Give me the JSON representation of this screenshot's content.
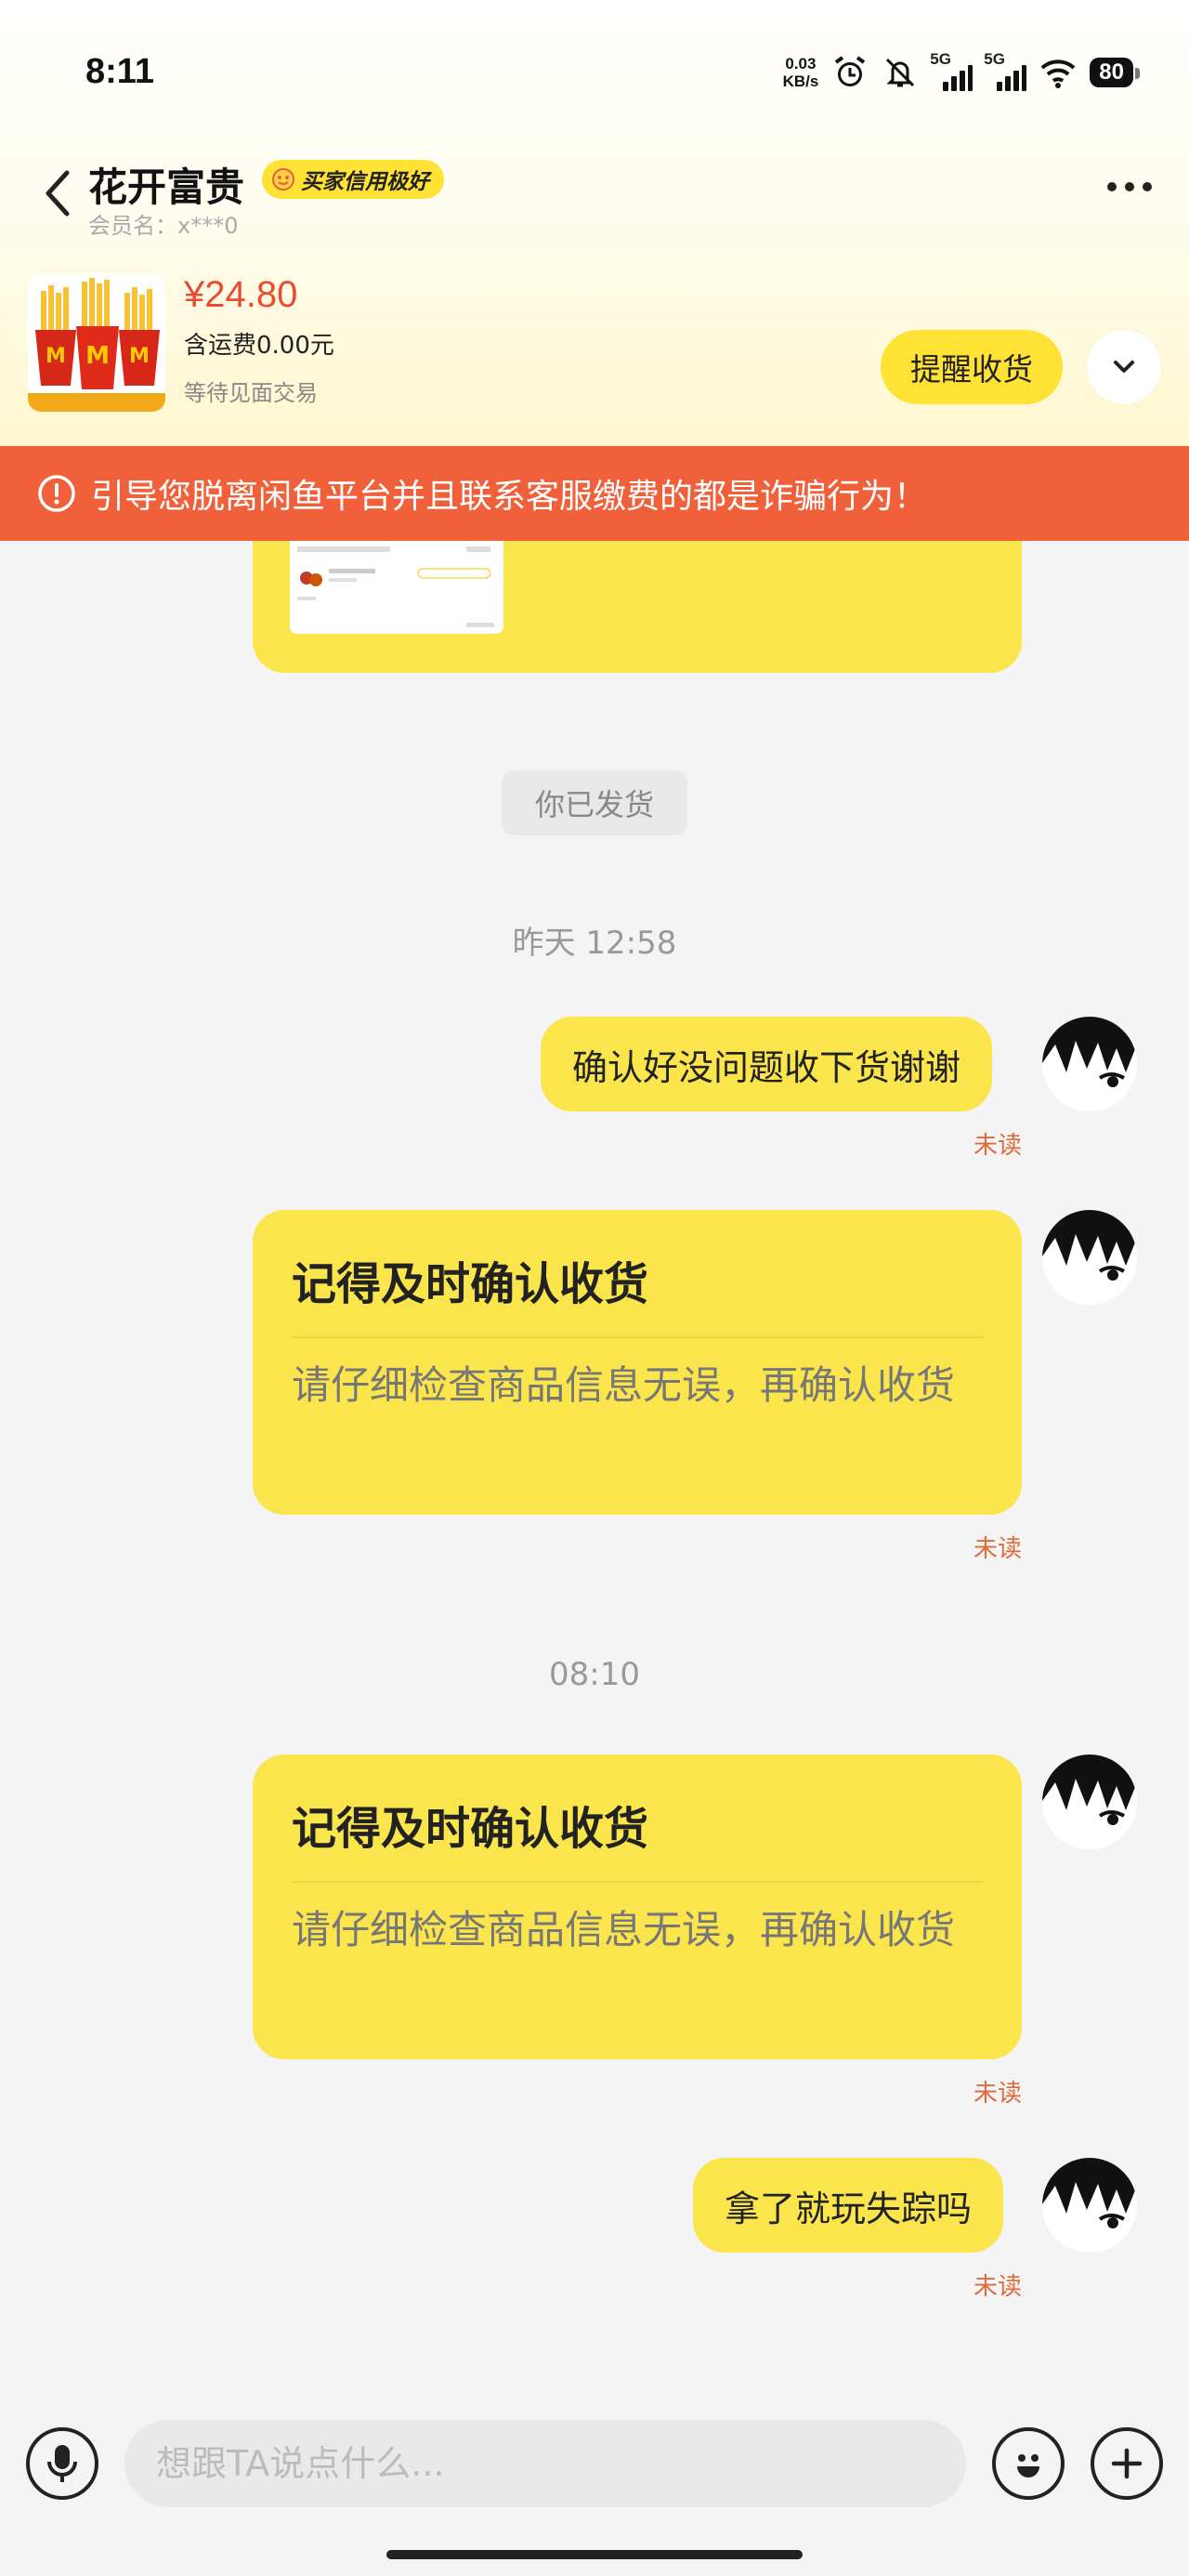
{
  "status_bar": {
    "time": "8:11",
    "net_speed_value": "0.03",
    "net_speed_unit": "KB/s",
    "sim1_label": "5G",
    "sim2_label": "5G",
    "battery": "80"
  },
  "header": {
    "seller_name": "花开富贵",
    "credit_badge": "买家信用极好",
    "member_label": "会员名：x***0"
  },
  "product": {
    "image": "fries-icon",
    "price": "¥24.80",
    "shipping": "含运费0.00元",
    "trade_status": "等待见面交易",
    "remind_button": "提醒收货"
  },
  "warning": {
    "text": "引导您脱离闲鱼平台并且联系客服缴费的都是诈骗行为！"
  },
  "chat": {
    "system_notice": "你已发货",
    "timestamp_1": "昨天 12:58",
    "msg_1": "确认好没问题收下货谢谢",
    "msg_1_status": "未读",
    "card_1": {
      "title": "记得及时确认收货",
      "body": "请仔细检查商品信息无误，再确认收货",
      "status": "未读"
    },
    "timestamp_2": "08:10",
    "card_2": {
      "title": "记得及时确认收货",
      "body": "请仔细检查商品信息无误，再确认收货",
      "status": "未读"
    },
    "msg_2": "拿了就玩失踪吗",
    "msg_2_status": "未读"
  },
  "input_bar": {
    "placeholder": "想跟TA说点什么..."
  },
  "colors": {
    "accent_yellow": "#fbe54c",
    "price_red": "#e94c2f",
    "warning_orange": "#f0603a",
    "unread_orange": "#e06a3c"
  }
}
